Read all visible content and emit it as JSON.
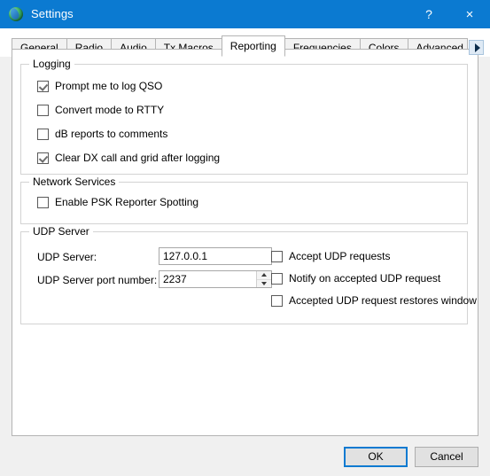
{
  "window": {
    "title": "Settings",
    "icon": "globe-icon",
    "help_label": "?",
    "close_label": "×",
    "accent_color": "#0b7ad1",
    "panel_background": "#ffffff",
    "footer_background": "#f0f0f0"
  },
  "tabs": {
    "items": [
      {
        "label": "General",
        "selected": false
      },
      {
        "label": "Radio",
        "selected": false
      },
      {
        "label": "Audio",
        "selected": false
      },
      {
        "label": "Tx Macros",
        "selected": false
      },
      {
        "label": "Reporting",
        "selected": true
      },
      {
        "label": "Frequencies",
        "selected": false
      },
      {
        "label": "Colors",
        "selected": false
      },
      {
        "label": "Advanced",
        "selected": false
      }
    ],
    "scroll_right_icon": "chevron-right-icon"
  },
  "groups": {
    "logging": {
      "legend": "Logging",
      "checkboxes": [
        {
          "label": "Prompt me to log QSO",
          "checked": true
        },
        {
          "label": "Convert mode to RTTY",
          "checked": false
        },
        {
          "label": "dB reports to comments",
          "checked": false
        },
        {
          "label": "Clear DX call and grid after logging",
          "checked": true
        }
      ]
    },
    "network_services": {
      "legend": "Network Services",
      "checkboxes": [
        {
          "label": "Enable PSK Reporter Spotting",
          "checked": false
        }
      ]
    },
    "udp_server": {
      "legend": "UDP Server",
      "server_label": "UDP Server:",
      "server_value": "127.0.0.1",
      "server_placeholder": "",
      "port_label": "UDP Server port number:",
      "port_value": "2237",
      "checkboxes": [
        {
          "label": "Accept UDP requests",
          "checked": false
        },
        {
          "label": "Notify on accepted UDP request",
          "checked": false
        },
        {
          "label": "Accepted UDP request restores window",
          "checked": false
        }
      ]
    }
  },
  "footer": {
    "ok_label": "OK",
    "cancel_label": "Cancel"
  }
}
